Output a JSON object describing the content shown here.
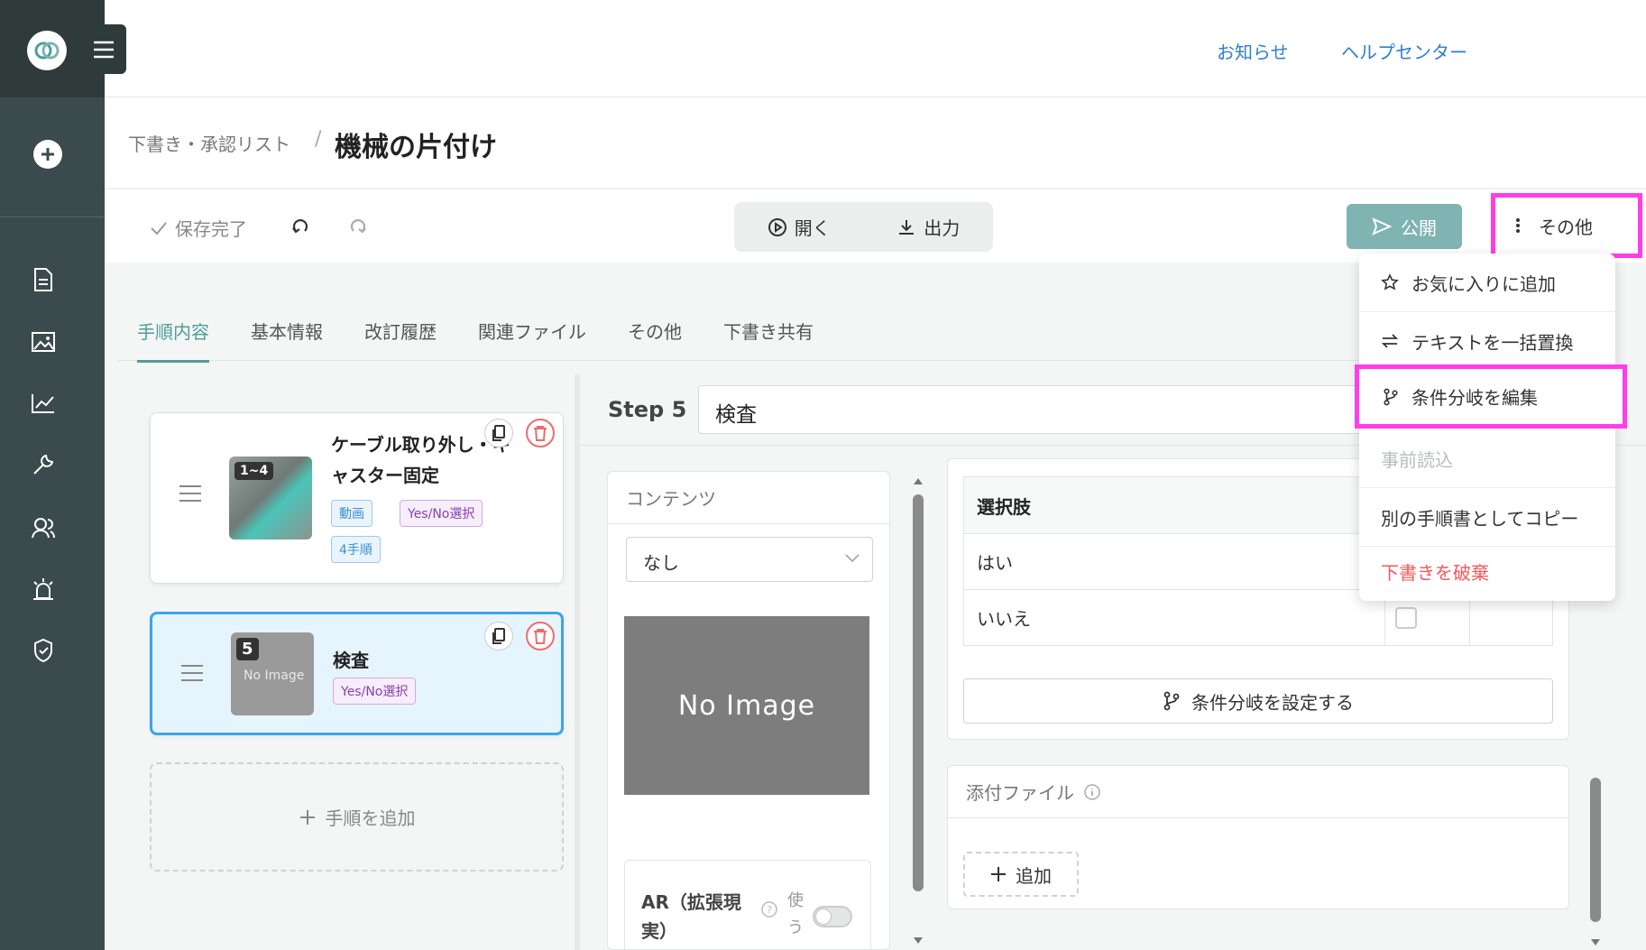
{
  "header": {
    "notice_link": "お知らせ",
    "help_link": "ヘルプセンター"
  },
  "breadcrumb": {
    "parent": "下書き・承認リスト",
    "separator": "/",
    "title": "機械の片付け"
  },
  "toolbar": {
    "save_status": "保存完了",
    "open_label": "開く",
    "export_label": "出力",
    "publish_label": "公開",
    "more_label": "その他"
  },
  "tabs": [
    {
      "label": "手順内容",
      "active": true
    },
    {
      "label": "基本情報",
      "active": false
    },
    {
      "label": "改訂履歴",
      "active": false
    },
    {
      "label": "関連ファイル",
      "active": false
    },
    {
      "label": "その他",
      "active": false
    },
    {
      "label": "下書き共有",
      "active": false
    }
  ],
  "steps": [
    {
      "badge": "1~4",
      "title_line1": "ケーブル取り外し・キ",
      "title_line2": "ャスター固定",
      "tags": [
        "動画",
        "Yes/No選択",
        "4手順"
      ]
    },
    {
      "badge": "5",
      "thumb_text": "No Image",
      "title_line1": "検査",
      "tags": [
        "Yes/No選択"
      ]
    }
  ],
  "add_step_label": "手順を追加",
  "editor": {
    "step_label": "Step 5",
    "step_title": "検査",
    "contents_header": "コンテンツ",
    "contents_select": "なし",
    "no_image": "No Image",
    "ar_label": "AR（拡張現実）",
    "ar_use": "使う"
  },
  "choices": {
    "header": "選択肢",
    "rows": [
      "はい",
      "いいえ"
    ],
    "branch_button": "条件分岐を設定する"
  },
  "attachments": {
    "header": "添付ファイル",
    "add_label": "追加"
  },
  "menu": {
    "items": [
      {
        "label": "お気に入りに追加",
        "icon": "star-icon"
      },
      {
        "label": "テキストを一括置換",
        "icon": "swap-icon"
      },
      {
        "label": "条件分岐を編集",
        "icon": "branch-icon"
      },
      {
        "label": "事前読込",
        "icon": ""
      },
      {
        "label": "別の手順書としてコピー",
        "icon": ""
      },
      {
        "label": "下書きを破棄",
        "icon": ""
      }
    ]
  },
  "colors": {
    "accent": "#4e9e9c",
    "highlight": "#ff3ee8",
    "danger": "#f05a5a",
    "link": "#2f7fcf",
    "sidebar": "#3b4a4c"
  }
}
